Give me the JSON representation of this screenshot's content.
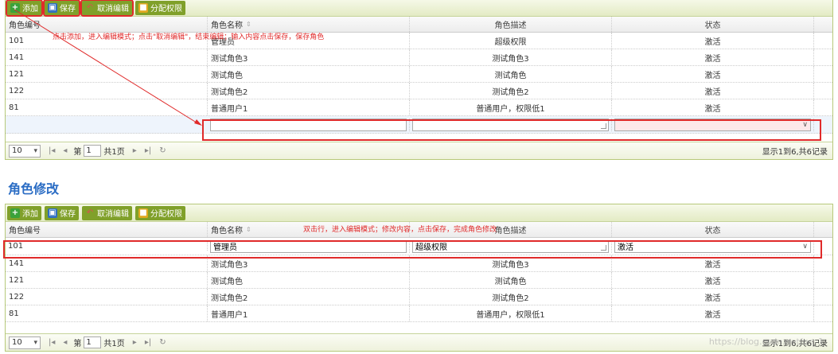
{
  "toolbar": {
    "add_label": "添加",
    "save_label": "保存",
    "cancel_label": "取消编辑",
    "perm_label": "分配权限"
  },
  "columns": [
    "角色编号",
    "角色名称",
    "角色描述",
    "状态"
  ],
  "panel1": {
    "rows": [
      {
        "id": "101",
        "name": "管理员",
        "desc": "超级权限",
        "status": "激活"
      },
      {
        "id": "141",
        "name": "测试角色3",
        "desc": "测试角色3",
        "status": "激活"
      },
      {
        "id": "121",
        "name": "测试角色",
        "desc": "测试角色",
        "status": "激活"
      },
      {
        "id": "122",
        "name": "测试角色2",
        "desc": "测试角色2",
        "status": "激活"
      },
      {
        "id": "81",
        "name": "普通用户1",
        "desc": "普通用户，权限低1",
        "status": "激活"
      }
    ],
    "annotation": "点击添加，进入编辑模式；点击\"取消编辑\"，结束编辑；输入内容点击保存，保存角色"
  },
  "section_title": "角色修改",
  "panel2": {
    "edit_row": {
      "id": "101",
      "name": "管理员",
      "desc": "超级权限",
      "status": "激活"
    },
    "rows": [
      {
        "id": "141",
        "name": "测试角色3",
        "desc": "测试角色3",
        "status": "激活"
      },
      {
        "id": "121",
        "name": "测试角色",
        "desc": "测试角色",
        "status": "激活"
      },
      {
        "id": "122",
        "name": "测试角色2",
        "desc": "测试角色2",
        "status": "激活"
      },
      {
        "id": "81",
        "name": "普通用户1",
        "desc": "普通用户，权限低1",
        "status": "激活"
      }
    ],
    "annotation": "双击行，进入编辑模式；修改内容，点击保存，完成角色修改"
  },
  "pager": {
    "page_size": "10",
    "page_prefix": "第",
    "page_value": "1",
    "page_total": "共1页",
    "info": "显示1到6,共6记录"
  },
  "watermark": "https://blog.csdn.net/qq_1"
}
